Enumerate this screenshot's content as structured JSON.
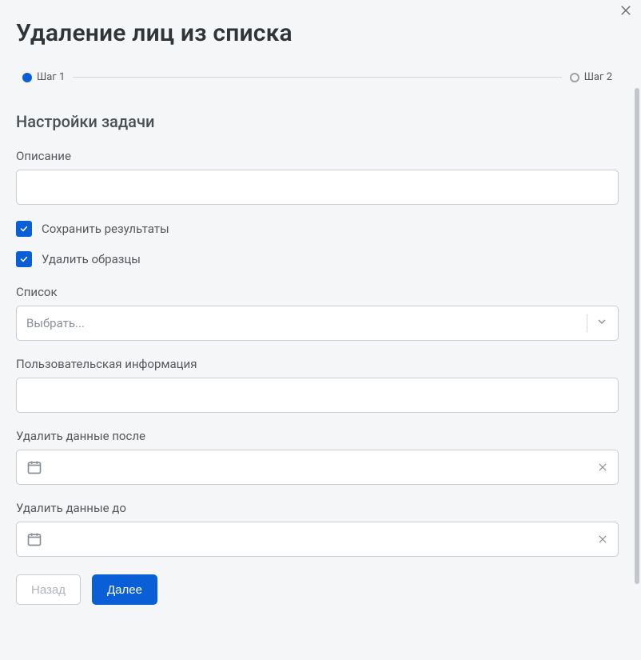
{
  "title": "Удаление лиц из списка",
  "stepper": {
    "step1": "Шаг 1",
    "step2": "Шаг 2"
  },
  "section_title": "Настройки задачи",
  "fields": {
    "description_label": "Описание",
    "description_value": "",
    "save_results_label": "Сохранить результаты",
    "save_results_checked": true,
    "delete_samples_label": "Удалить образцы",
    "delete_samples_checked": true,
    "list_label": "Список",
    "list_placeholder": "Выбрать...",
    "user_info_label": "Пользовательская информация",
    "user_info_value": "",
    "delete_after_label": "Удалить данные после",
    "delete_after_value": "",
    "delete_before_label": "Удалить данные до",
    "delete_before_value": ""
  },
  "buttons": {
    "back": "Назад",
    "next": "Далее"
  }
}
